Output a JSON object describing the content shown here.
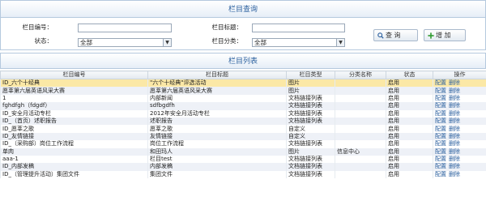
{
  "query": {
    "title": "栏目查询",
    "fields": {
      "id_label": "栏目编号：",
      "title_label": "栏目标题：",
      "status_label": "状态：",
      "category_label": "栏目分类：",
      "status_value": "全部",
      "category_value": "全部"
    },
    "buttons": {
      "search": "查 询",
      "add": "增 加"
    }
  },
  "list": {
    "title": "栏目列表",
    "columns": [
      "栏目编号",
      "栏目标题",
      "栏目类型",
      "分类名称",
      "状态",
      "操作"
    ],
    "actions": {
      "config": "配置",
      "delete": "删除"
    },
    "rows": [
      {
        "id": "ID_六个十经典",
        "title": "\"六个十经典\"评选活动",
        "type": "图片",
        "category": "",
        "status": "启用"
      },
      {
        "id": "愿莘第六届英语风采大赛",
        "title": "愿莘第六届英语风采大赛",
        "type": "图片",
        "category": "",
        "status": "启用"
      },
      {
        "id": "1",
        "title": "内部新闻",
        "type": "文档链接列表",
        "category": "",
        "status": "启用"
      },
      {
        "id": "fghdfgh（fdgdf）",
        "title": "sdfbgdfh",
        "type": "文档链接列表",
        "category": "",
        "status": "启用"
      },
      {
        "id": "ID_安全月活动专栏",
        "title": "2012年安全月活动专栏",
        "type": "文档链接列表",
        "category": "",
        "status": "启用"
      },
      {
        "id": "ID_（首页）述职报告",
        "title": "述职报告",
        "type": "文档链接列表",
        "category": "",
        "status": "启用"
      },
      {
        "id": "ID_愿莘之歌",
        "title": "愿莘之歌",
        "type": "自定义",
        "category": "",
        "status": "启用"
      },
      {
        "id": "ID_友情链接",
        "title": "友情链接",
        "type": "自定义",
        "category": "",
        "status": "启用"
      },
      {
        "id": "ID_（采购部）岗位工作流程",
        "title": "岗位工作流程",
        "type": "文档链接列表",
        "category": "",
        "status": "启用"
      },
      {
        "id": "单肉",
        "title": "和田玛人",
        "type": "图片",
        "category": "信息中心",
        "status": "启用"
      },
      {
        "id": "aaa-1",
        "title": "栏目test",
        "type": "文档链接列表",
        "category": "",
        "status": "启用"
      },
      {
        "id": "ID_内部发稿",
        "title": "内部发稿",
        "type": "文档链接列表",
        "category": "",
        "status": "启用"
      },
      {
        "id": "ID_（管理提升活动）集团文件",
        "title": "集团文件",
        "type": "文档链接列表",
        "category": "",
        "status": "启用"
      }
    ]
  },
  "colors": {
    "accent": "#2a5f9e",
    "selected_row": "#fbe8a6",
    "alt_row": "#eef1f7"
  }
}
